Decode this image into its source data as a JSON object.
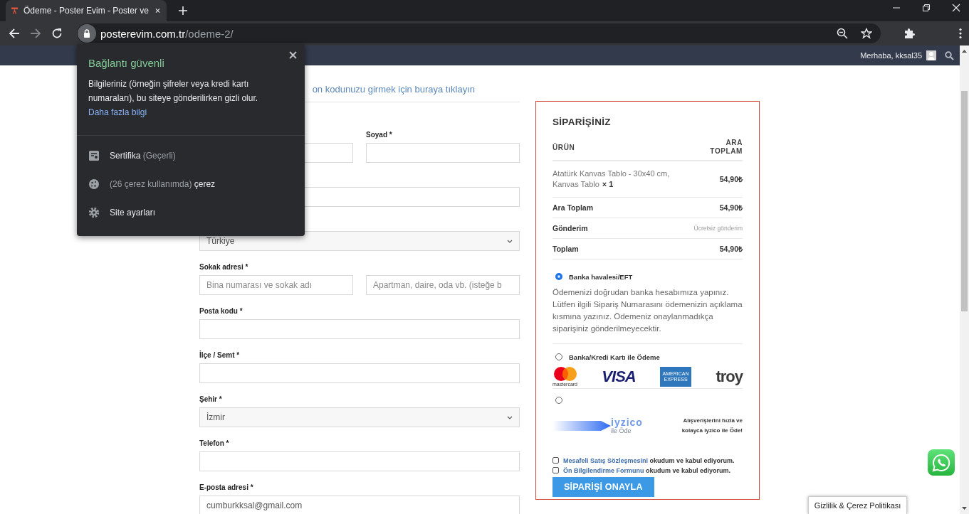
{
  "browser": {
    "tab": {
      "title": "Ödeme - Poster Evim - Poster ve",
      "selected": true
    },
    "url": {
      "host": "posterevim.com.tr",
      "path": "/odeme-2/"
    }
  },
  "admin_bar": {
    "greeting": "Merhaba, kksal35"
  },
  "coupon_link": "on kodunuzu girmek için buraya tıklayın",
  "form": {
    "rows": [
      {
        "fields": [
          {
            "kind": "text"
          },
          {
            "kind": "text",
            "label": "Soyad *"
          }
        ]
      },
      {
        "fields": [
          {
            "kind": "text"
          }
        ]
      },
      {
        "fields": [
          {
            "kind": "select",
            "value": "Türkiye"
          }
        ]
      },
      {
        "fields": [
          {
            "kind": "text",
            "label": "Sokak adresi *",
            "placeholder": "Bina numarası ve sokak adı"
          },
          {
            "kind": "text",
            "placeholder": "Apartman, daire, oda vb. (isteğe b"
          }
        ]
      },
      {
        "fields": [
          {
            "kind": "text",
            "label": "Posta kodu *"
          }
        ]
      },
      {
        "fields": [
          {
            "kind": "text",
            "label": "İlçe / Semt *"
          }
        ]
      },
      {
        "fields": [
          {
            "kind": "select",
            "label": "Şehir *",
            "value": "İzmir"
          }
        ]
      },
      {
        "fields": [
          {
            "kind": "text",
            "label": "Telefon *"
          }
        ]
      },
      {
        "fields": [
          {
            "kind": "text",
            "label": "E-posta adresi *",
            "value": "cumburkksal@gmail.com"
          }
        ]
      }
    ]
  },
  "order": {
    "title": "SİPARİŞİNİZ",
    "columns": [
      "ÜRÜN",
      "ARA TOPLAM"
    ],
    "items": [
      {
        "name": "Atatürk Kanvas Tablo - 30x40 cm, Kanvas Tablo",
        "quantity": "× 1",
        "price": "54,90₺"
      }
    ],
    "totals": [
      {
        "label": "Ara Toplam",
        "value": "54,90₺",
        "kind": "amount"
      },
      {
        "label": "Gönderim",
        "value": "Ücretsiz gönderim",
        "kind": "note"
      },
      {
        "label": "Toplam",
        "value": "54,90₺",
        "kind": "amount"
      }
    ],
    "payment_methods": [
      {
        "kind": "bank",
        "label": "Banka havalesi/EFT",
        "selected": true,
        "description": "Ödemenizi doğrudan banka hesabımıza yapınız. Lütfen ilgili Sipariş Numarasını ödemenizin açıklama kısmına yazınız. Ödemeniz onaylanmadıkça siparişiniz gönderilmeyecektir."
      },
      {
        "kind": "card",
        "label": "Banka/Kredi Kartı ile Ödeme",
        "selected": false,
        "logos": [
          {
            "kind": "mastercard",
            "text": "mastercard"
          },
          {
            "kind": "visa",
            "text": "VISA"
          },
          {
            "kind": "amex",
            "text": "AMERICAN EXPRESS"
          },
          {
            "kind": "troy",
            "text": "troy"
          }
        ]
      },
      {
        "kind": "iyzico",
        "selected": false,
        "logo_text": "iyzico",
        "logo_subtext": "ile Öde",
        "description": "Alışverişlerini hızla ve kolayca iyzico ile Öde!"
      }
    ],
    "agreements": [
      {
        "link": "Mesafeli Satış Sözleşmesini",
        "text": "okudum ve kabul ediyorum.",
        "checked": false
      },
      {
        "link": "Ön Bilgilendirme Formunu",
        "text": "okudum ve kabul ediyorum.",
        "checked": false
      }
    ],
    "submit": "SİPARİŞİ ONAYLA"
  },
  "security_popup": {
    "title": "Bağlantı güvenli",
    "description": "Bilgileriniz (örneğin şifreler veya kredi kartı numaraları), bu siteye gönderilirken gizli olur.",
    "link": "Daha fazla bilgi",
    "items": [
      {
        "kind": "certificate",
        "label": "Sertifika",
        "detail": "(Geçerli)"
      },
      {
        "kind": "cookies",
        "detail": "(26 çerez kullanımda)",
        "label": "çerez"
      },
      {
        "kind": "settings",
        "label": "Site ayarları"
      }
    ]
  },
  "privacy_tab": "Gizlilik & Çerez Politikası"
}
